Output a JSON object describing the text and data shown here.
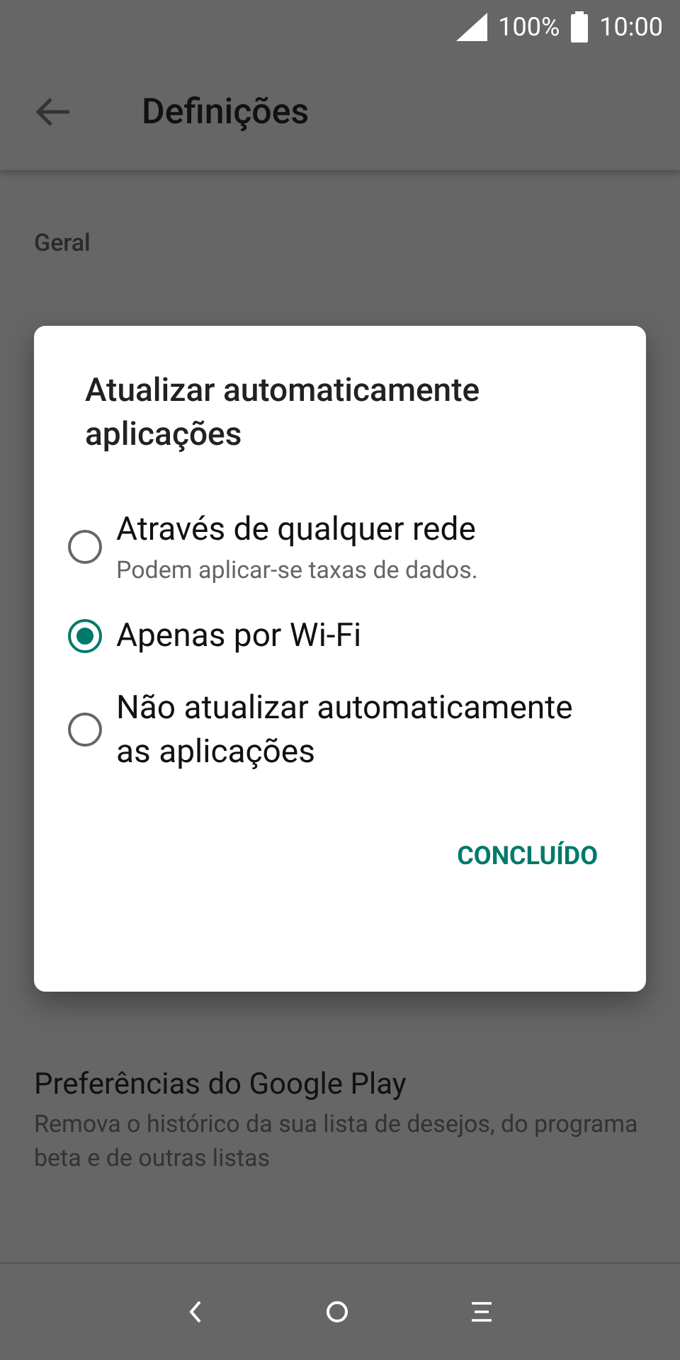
{
  "status_bar": {
    "battery": "100%",
    "time": "10:00"
  },
  "app_bar": {
    "title": "Definições"
  },
  "section": {
    "header": "Geral"
  },
  "preference": {
    "title": "Preferências do Google Play",
    "summary": "Remova o histórico da sua lista de desejos, do programa beta e de outras listas"
  },
  "dialog": {
    "title": "Atualizar automaticamente aplicações",
    "options": [
      {
        "label": "Através de qualquer rede",
        "hint": "Podem aplicar-se taxas de dados.",
        "selected": false
      },
      {
        "label": "Apenas por Wi-Fi",
        "selected": true
      },
      {
        "label": "Não atualizar automaticamente as aplicações",
        "selected": false
      }
    ],
    "button": "CONCLUÍDO"
  }
}
